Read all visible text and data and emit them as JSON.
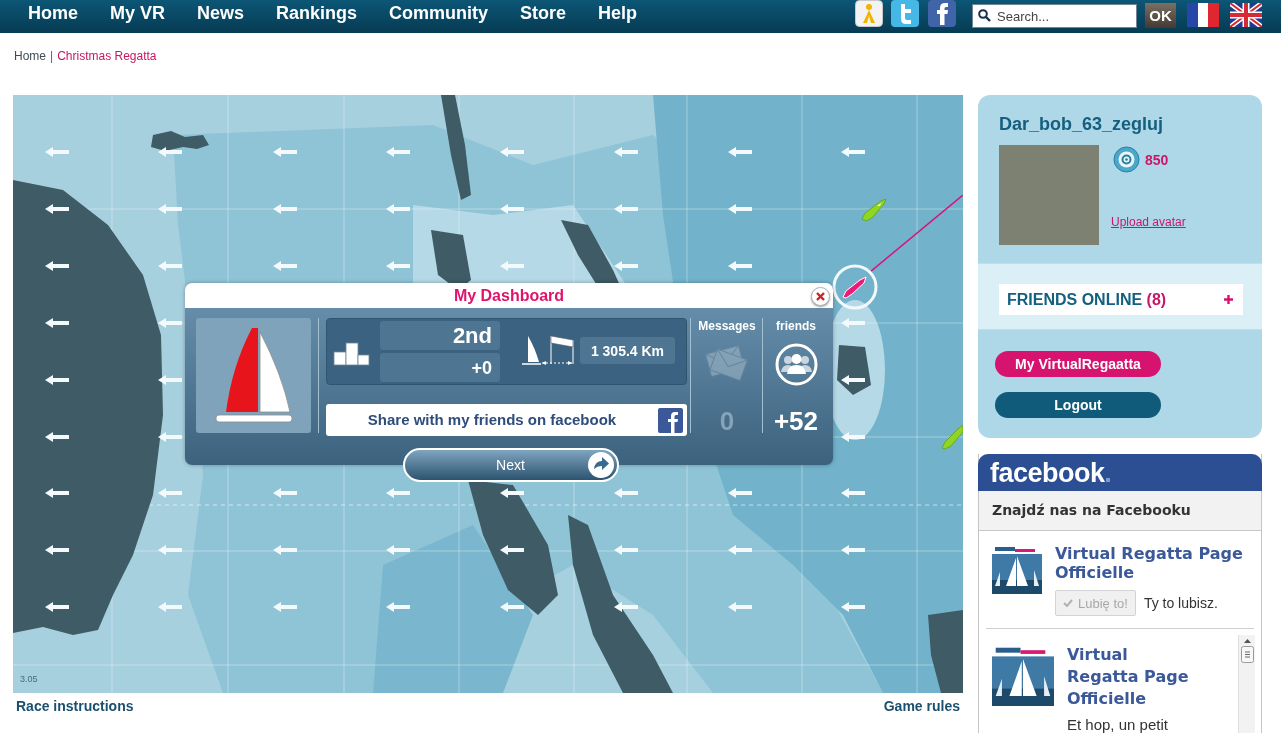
{
  "nav": {
    "links": [
      "Home",
      "My VR",
      "News",
      "Rankings",
      "Community",
      "Store",
      "Help"
    ],
    "search": {
      "placeholder": "Search..."
    },
    "search_button": "OK"
  },
  "breadcrumb": {
    "separator": "|",
    "items": [
      {
        "label": "Home",
        "current": false
      },
      {
        "label": "Christmas Regatta",
        "current": true
      }
    ]
  },
  "map": {
    "version": "3.05"
  },
  "dashboard": {
    "title": "My Dashboard",
    "rank": "2nd",
    "rank_change": "+0",
    "distance_to_finish": "1 305.4 Km",
    "share_button": "Share with my friends on facebook",
    "messages": {
      "label": "Messages",
      "count": "0",
      "disabled": true
    },
    "friends": {
      "label": "friends",
      "count": "+52"
    },
    "next_button": "Next"
  },
  "map_links": [
    "Race instructions",
    "Game rules"
  ],
  "profile": {
    "username": "Dar_bob_63_zegluj",
    "points": "850",
    "upload_link": "Upload avatar",
    "friends_online": {
      "label": "FRIENDS ONLINE",
      "count": "(8)"
    },
    "buttons": [
      {
        "label": "My VirtualRegaatta",
        "kind": "primary"
      },
      {
        "label": "Logout",
        "kind": "secondary"
      }
    ]
  },
  "facebook_box": {
    "logo": "facebook",
    "heading": "Znajdź nas na Facebooku",
    "page_name": "Virtual Regatta Page Officielle",
    "like_button": "Lubię to!",
    "liked": true,
    "like_status": "Ty to lubisz.",
    "posts": [
      {
        "author": "Virtual Regatta Page Officielle",
        "text": "Et hop, un petit"
      }
    ]
  }
}
